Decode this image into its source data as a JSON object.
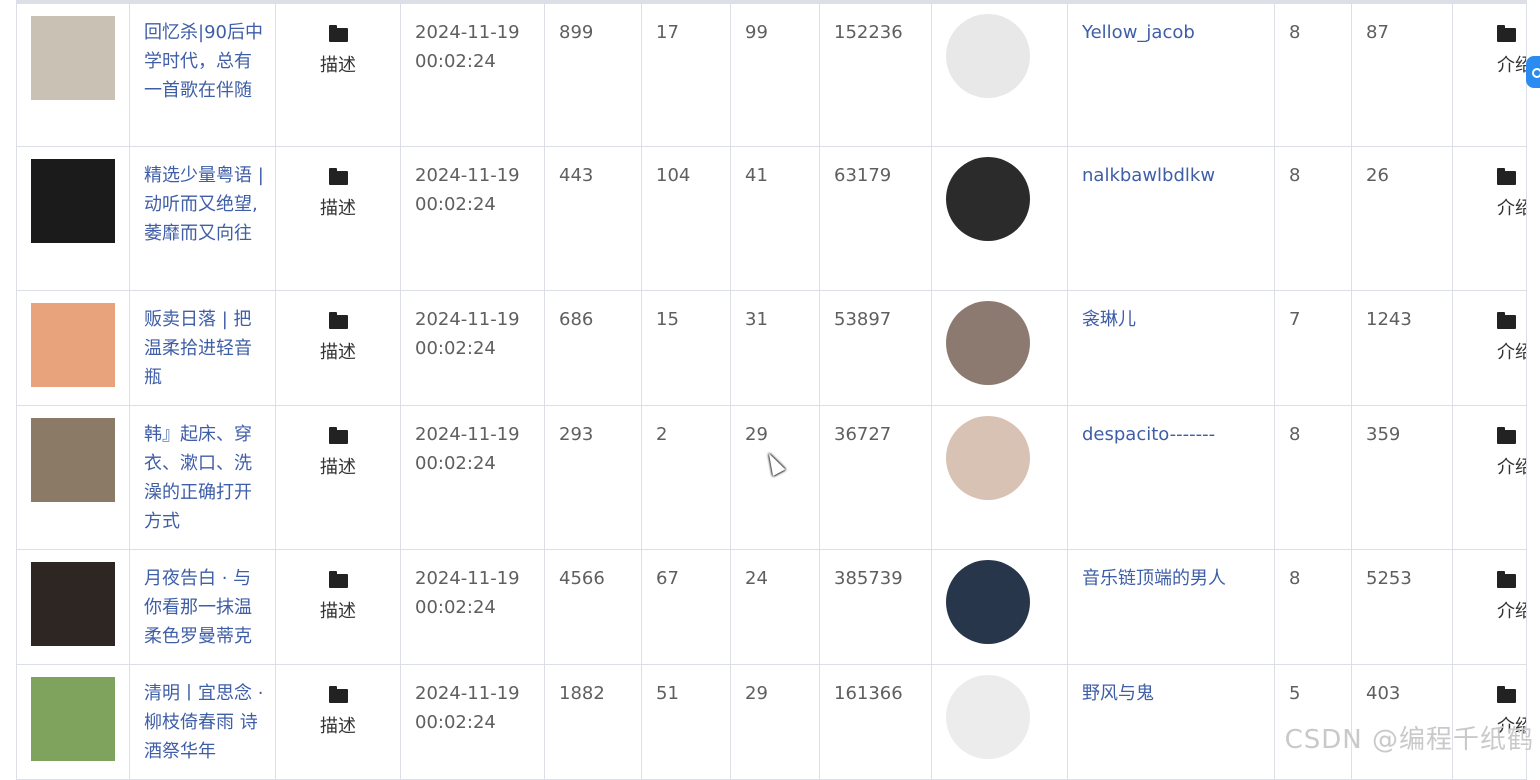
{
  "rows": [
    {
      "title": "回忆杀|90后中学时代，总有一首歌在伴随",
      "desc": "描述",
      "date": "2024-11-19",
      "time": "00:02:24",
      "c1": "899",
      "c2": "17",
      "c3": "99",
      "c4": "152236",
      "user": "Yellow_jacob",
      "n1": "8",
      "n2": "87",
      "intro": "介绍",
      "cover_color": "#c9c2b4",
      "avatar_color": "#e8e8e8"
    },
    {
      "title": "精选少量粤语 | 动听而又绝望,萎靡而又向往",
      "desc": "描述",
      "date": "2024-11-19",
      "time": "00:02:24",
      "c1": "443",
      "c2": "104",
      "c3": "41",
      "c4": "63179",
      "user": "nalkbawlbdlkw",
      "n1": "8",
      "n2": "26",
      "intro": "介绍",
      "cover_color": "#1b1b1b",
      "avatar_color": "#2b2b2b"
    },
    {
      "title": "贩卖日落 | 把温柔拾进轻音瓶",
      "desc": "描述",
      "date": "2024-11-19",
      "time": "00:02:24",
      "c1": "686",
      "c2": "15",
      "c3": "31",
      "c4": "53897",
      "user": "衾琳儿",
      "n1": "7",
      "n2": "1243",
      "intro": "介绍",
      "cover_color": "#e8a27c",
      "avatar_color": "#8c7a70"
    },
    {
      "title": "韩』起床、穿衣、漱口、洗澡的正确打开方式",
      "desc": "描述",
      "date": "2024-11-19",
      "time": "00:02:24",
      "c1": "293",
      "c2": "2",
      "c3": "29",
      "c4": "36727",
      "user": "despacito-------",
      "n1": "8",
      "n2": "359",
      "intro": "介绍",
      "cover_color": "#8b7a66",
      "avatar_color": "#d8c2b4"
    },
    {
      "title": "月夜告白 · 与你看那一抹温柔色罗曼蒂克",
      "desc": "描述",
      "date": "2024-11-19",
      "time": "00:02:24",
      "c1": "4566",
      "c2": "67",
      "c3": "24",
      "c4": "385739",
      "user": "音乐链顶端的男人",
      "n1": "8",
      "n2": "5253",
      "intro": "介绍",
      "cover_color": "#2e2622",
      "avatar_color": "#27364a"
    },
    {
      "title": "清明丨宜思念 · 柳枝倚春雨 诗酒祭华年",
      "desc": "描述",
      "date": "2024-11-19",
      "time": "00:02:24",
      "c1": "1882",
      "c2": "51",
      "c3": "29",
      "c4": "161366",
      "user": "野风与鬼",
      "n1": "5",
      "n2": "403",
      "intro": "介绍",
      "cover_color": "#7fa35c",
      "avatar_color": "#ececec"
    }
  ],
  "watermark": "CSDN @编程千纸鹤"
}
